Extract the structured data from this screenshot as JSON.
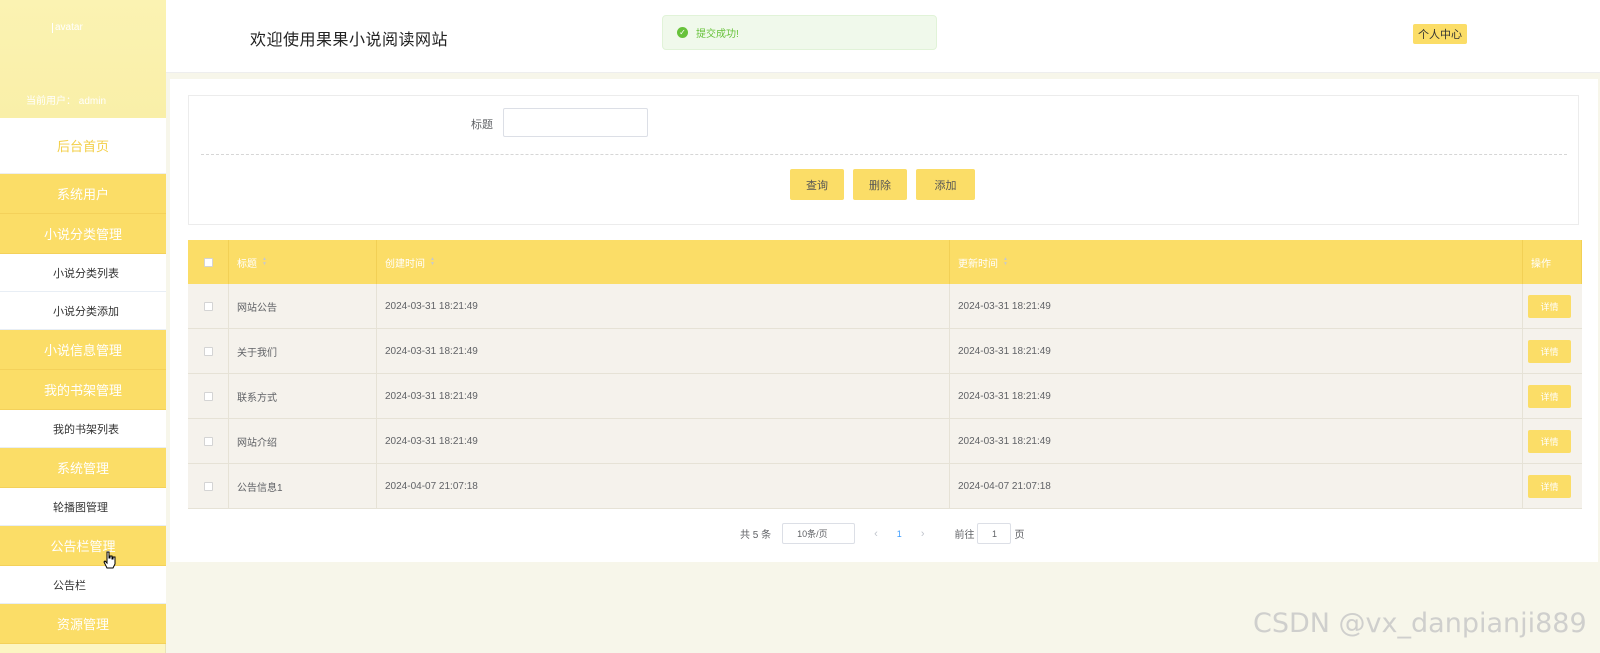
{
  "sidebar": {
    "avatar_alt": "avatar",
    "current_user": "当前用户：  admin",
    "menu": [
      {
        "type": "home",
        "label": "后台首页"
      },
      {
        "type": "group",
        "label": "系统用户"
      },
      {
        "type": "group",
        "label": "小说分类管理"
      },
      {
        "type": "sub",
        "label": "小说分类列表"
      },
      {
        "type": "sub",
        "label": "小说分类添加"
      },
      {
        "type": "group",
        "label": "小说信息管理"
      },
      {
        "type": "group",
        "label": "我的书架管理"
      },
      {
        "type": "sub",
        "label": "我的书架列表"
      },
      {
        "type": "group",
        "label": "系统管理"
      },
      {
        "type": "sub",
        "label": "轮播图管理"
      },
      {
        "type": "group",
        "label": "公告栏管理"
      },
      {
        "type": "sub",
        "label": "公告栏"
      },
      {
        "type": "group",
        "label": "资源管理"
      }
    ]
  },
  "header": {
    "welcome": "欢迎使用果果小说阅读网站",
    "toast": "提交成功!",
    "profile_button": "个人中心"
  },
  "search": {
    "label": "标题",
    "placeholder": "",
    "buttons": {
      "query": "查询",
      "delete": "删除",
      "add": "添加"
    }
  },
  "table": {
    "columns": [
      "标题",
      "创建时间",
      "更新时间",
      "操作"
    ],
    "rows": [
      {
        "title": "网站公告",
        "created": "2024-03-31 18:21:49",
        "updated": "2024-03-31 18:21:49",
        "action": "详情"
      },
      {
        "title": "关于我们",
        "created": "2024-03-31 18:21:49",
        "updated": "2024-03-31 18:21:49",
        "action": "详情"
      },
      {
        "title": "联系方式",
        "created": "2024-03-31 18:21:49",
        "updated": "2024-03-31 18:21:49",
        "action": "详情"
      },
      {
        "title": "网站介绍",
        "created": "2024-03-31 18:21:49",
        "updated": "2024-03-31 18:21:49",
        "action": "详情"
      },
      {
        "title": "公告信息1",
        "created": "2024-04-07 21:07:18",
        "updated": "2024-04-07 21:07:18",
        "action": "详情"
      }
    ]
  },
  "pagination": {
    "total": "共 5 条",
    "page_size": "10条/页",
    "current_page": "1",
    "goto_label": "前往",
    "goto_value": "1",
    "page_word": "页"
  },
  "watermark": "CSDN @vx_danpianji889",
  "colors": {
    "accent": "#fbdd67",
    "sidebar_bg": "#fcf5c2",
    "row_bg": "#f5f2ec",
    "success": "#67c23a"
  }
}
